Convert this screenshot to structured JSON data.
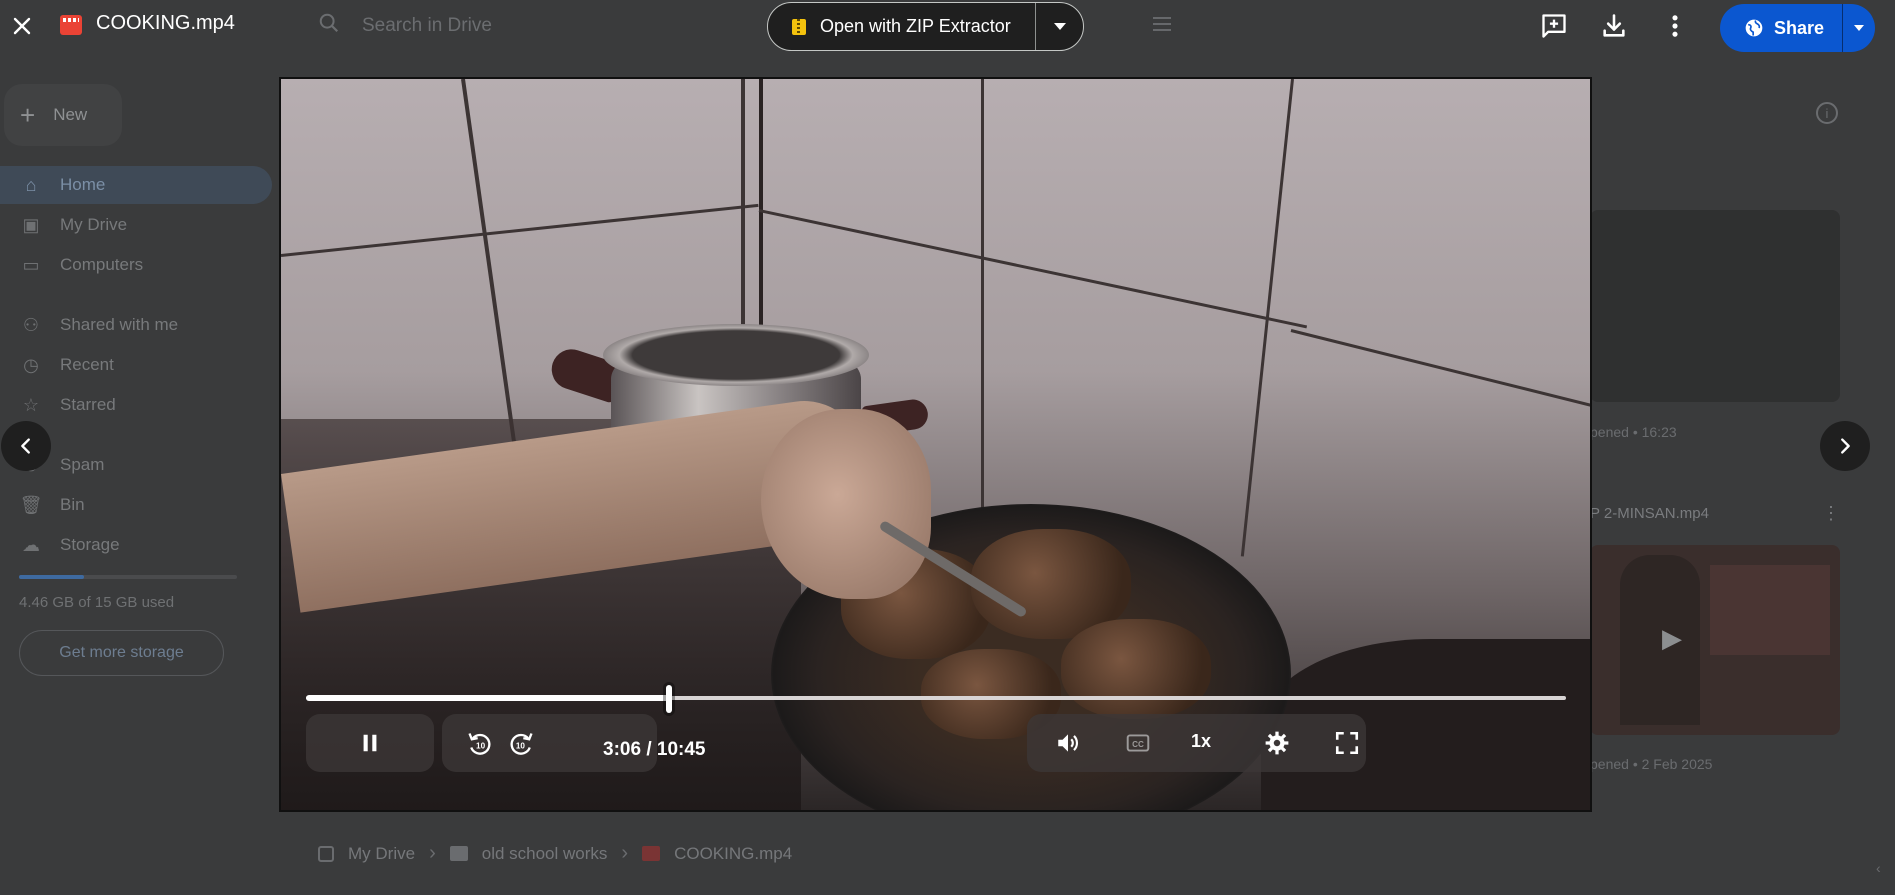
{
  "app": {
    "file_title": "COOKING.mp4"
  },
  "toolbar": {
    "open_with_label": "Open with ZIP Extractor",
    "share_label": "Share",
    "icons": [
      "close-icon",
      "video-file-icon",
      "add-comment-icon",
      "download-icon",
      "more-vert-icon",
      "globe-icon"
    ]
  },
  "background_page": {
    "search_placeholder": "Search in Drive",
    "new_button": "New",
    "sidebar": {
      "items": [
        {
          "label": "Home",
          "icon": "home-icon"
        },
        {
          "label": "My Drive",
          "icon": "my-drive-icon"
        },
        {
          "label": "Computers",
          "icon": "computer-icon"
        },
        {
          "label": "Shared with me",
          "icon": "people-icon"
        },
        {
          "label": "Recent",
          "icon": "clock-icon"
        },
        {
          "label": "Starred",
          "icon": "star-icon"
        },
        {
          "label": "Spam",
          "icon": "spam-icon"
        },
        {
          "label": "Bin",
          "icon": "trash-icon"
        },
        {
          "label": "Storage",
          "icon": "cloud-icon"
        }
      ]
    },
    "storage": {
      "usage_text": "4.46 GB of 15 GB used",
      "used_fraction": 0.297,
      "button_label": "Get more storage"
    },
    "files": [
      {
        "meta": "pened • 16:23"
      },
      {
        "name": "P 2-MINSAN.mp4",
        "meta": "pened • 2 Feb 2025"
      }
    ],
    "breadcrumb": [
      "My Drive",
      "old school works",
      "COOKING.mp4"
    ]
  },
  "player": {
    "state": "playing",
    "current_time": "3:06",
    "time_separator": "/",
    "duration": "10:45",
    "progress_fraction": 0.2884,
    "speed": "1x",
    "icons": [
      "pause-icon",
      "rewind-10-icon",
      "forward-10-icon",
      "volume-icon",
      "captions-icon",
      "settings-icon",
      "fullscreen-icon"
    ]
  },
  "colors": {
    "share_blue": "#0b57d0",
    "file_red": "#ea4335",
    "zip_yellow": "#f4c20d"
  }
}
